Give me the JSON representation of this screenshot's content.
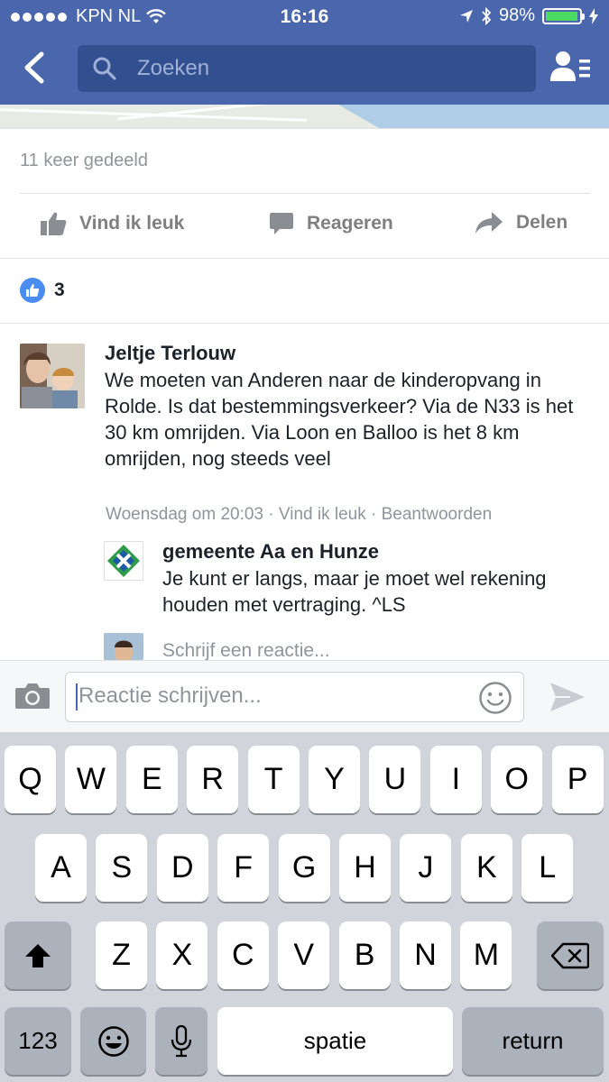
{
  "status_bar": {
    "carrier": "KPN NL",
    "time": "16:16",
    "battery": "98%",
    "battery_level": 0.98,
    "battery_color": "#4cd964"
  },
  "nav": {
    "back_icon": "chevron-left-icon",
    "search_placeholder": "Zoeken",
    "friends_icon": "friend-list-icon",
    "bar_color": "#4a67ad"
  },
  "post": {
    "shares": "11 keer gedeeld",
    "actions": {
      "like": "Vind ik leuk",
      "comment": "Reageren",
      "share": "Delen"
    },
    "reaction_count": "3"
  },
  "comments": [
    {
      "name": "Jeltje Terlouw",
      "text": "We moeten van Anderen naar de kinderopvang in Rolde. Is dat bestemmingsverkeer? Via de N33 is het 30 km omrijden. Via Loon en Balloo is het 8 km omrijden, nog steeds veel",
      "time": "Woensdag om 20:03",
      "like": "Vind ik leuk",
      "reply": "Beantwoorden",
      "separator": "·"
    },
    {
      "name": "gemeente Aa en Hunze",
      "text": "Je kunt er langs, maar je moet wel rekening houden met vertraging.  ^LS"
    }
  ],
  "reply_placeholder": "Schrijf een reactie...",
  "composer": {
    "placeholder": "Reactie schrijven...",
    "camera_icon": "camera-icon",
    "emoji_icon": "smiley-icon",
    "send_icon": "send-icon"
  },
  "keyboard": {
    "row1": [
      "Q",
      "W",
      "E",
      "R",
      "T",
      "Y",
      "U",
      "I",
      "O",
      "P"
    ],
    "row2": [
      "A",
      "S",
      "D",
      "F",
      "G",
      "H",
      "J",
      "K",
      "L"
    ],
    "row3": [
      "Z",
      "X",
      "C",
      "V",
      "B",
      "N",
      "M"
    ],
    "numbers": "123",
    "space": "spatie",
    "return": "return",
    "shift_icon": "shift-icon",
    "delete_icon": "backspace-icon",
    "emoji_icon": "emoji-icon",
    "mic_icon": "microphone-icon"
  }
}
